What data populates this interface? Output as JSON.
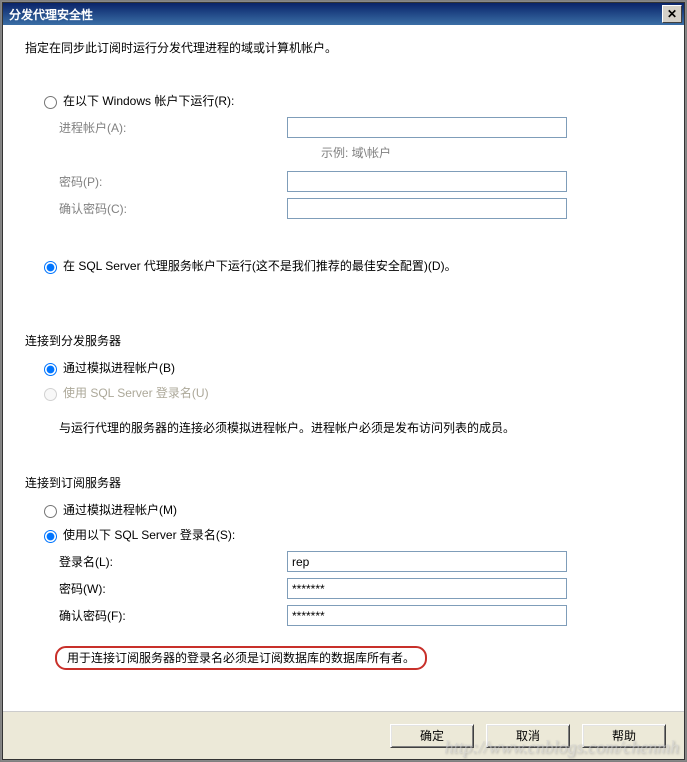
{
  "titlebar": {
    "title": "分发代理安全性",
    "close_x": "✕"
  },
  "intro": "指定在同步此订阅时运行分发代理进程的域或计算机帐户。",
  "section1": {
    "radio_windows": "在以下 Windows 帐户下运行(R):",
    "process_account": "进程帐户(A):",
    "example": "示例: 域\\帐户",
    "password": "密码(P):",
    "confirm_password": "确认密码(C):",
    "radio_sqlagent": "在 SQL Server 代理服务帐户下运行(这不是我们推荐的最佳安全配置)(D)。"
  },
  "section2": {
    "title": "连接到分发服务器",
    "radio_impersonate": "通过模拟进程帐户(B)",
    "radio_sqllogin": "使用 SQL Server 登录名(U)",
    "hint": "与运行代理的服务器的连接必须模拟进程帐户。进程帐户必须是发布访问列表的成员。"
  },
  "section3": {
    "title": "连接到订阅服务器",
    "radio_impersonate": "通过模拟进程帐户(M)",
    "radio_sqllogin": "使用以下 SQL Server 登录名(S):",
    "login_label": "登录名(L):",
    "login_value": "rep",
    "password_label": "密码(W):",
    "password_value": "*******",
    "confirm_label": "确认密码(F):",
    "confirm_value": "*******",
    "red_note": "用于连接订阅服务器的登录名必须是订阅数据库的数据库所有者。"
  },
  "buttons": {
    "ok": "确定",
    "cancel": "取消",
    "help": "帮助"
  },
  "watermark": "http://www.cnblogs.com/chenmh"
}
